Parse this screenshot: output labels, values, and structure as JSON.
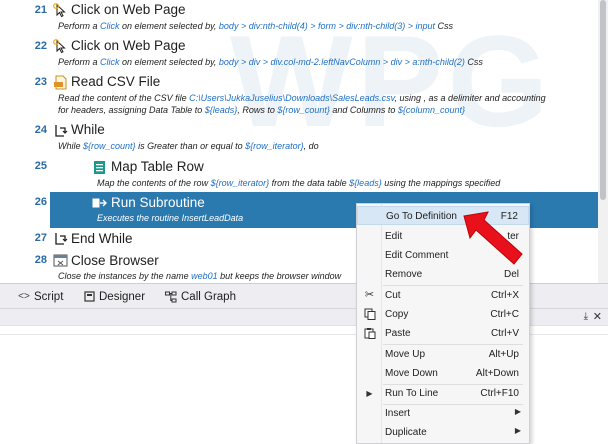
{
  "watermark": "WPG",
  "steps": [
    {
      "num": "21",
      "title": "Click on Web Page",
      "desc": [
        {
          "t": "Perform a "
        },
        {
          "t": "Click",
          "link": true
        },
        {
          "t": " on element selected by, "
        },
        {
          "t": "body > div:nth-child(4) > form > div:nth-child(3) > input",
          "link": true
        },
        {
          "t": " Css"
        }
      ]
    },
    {
      "num": "22",
      "title": "Click on Web Page",
      "desc": [
        {
          "t": "Perform a "
        },
        {
          "t": "Click",
          "link": true
        },
        {
          "t": " on element selected by, "
        },
        {
          "t": "body > div > div.col-md-2.leftNavColumn > div > a:nth-child(2)",
          "link": true
        },
        {
          "t": " Css"
        }
      ]
    },
    {
      "num": "23",
      "title": "Read CSV File",
      "desc": [
        {
          "t": "Read the content of the CSV file "
        },
        {
          "t": "C:\\Users\\JukkaJuselius\\Downloads\\SalesLeads.csv",
          "link": true
        },
        {
          "t": ", using , as a delimiter and  accounting"
        }
      ],
      "desc2": [
        {
          "t": "for headers, assigning Data Table to "
        },
        {
          "t": "${leads}",
          "link": true
        },
        {
          "t": ", Rows to "
        },
        {
          "t": "${row_count}",
          "link": true
        },
        {
          "t": " and Columns to "
        },
        {
          "t": "${column_count}",
          "link": true
        }
      ]
    },
    {
      "num": "24",
      "title": "While",
      "desc": [
        {
          "t": "While "
        },
        {
          "t": "${row_count}",
          "link": true
        },
        {
          "t": " is Greater than or equal to "
        },
        {
          "t": "${row_iterator}",
          "link": true
        },
        {
          "t": ", do"
        }
      ]
    },
    {
      "num": "25",
      "title": "Map Table Row",
      "desc": [
        {
          "t": "Map the contents of the row "
        },
        {
          "t": "${row_iterator}",
          "link": true
        },
        {
          "t": " from the data table "
        },
        {
          "t": "${leads}",
          "link": true
        },
        {
          "t": " using the mappings specified"
        }
      ]
    },
    {
      "num": "26",
      "title": "Run Subroutine",
      "desc": [
        {
          "t": "Executes the routine "
        },
        {
          "t": "InsertLeadData",
          "link": true
        }
      ]
    },
    {
      "num": "27",
      "title": "End While",
      "desc": []
    },
    {
      "num": "28",
      "title": "Close Browser",
      "desc": [
        {
          "t": "Close the instances by the name "
        },
        {
          "t": "web01",
          "link": true
        },
        {
          "t": " but keeps the browser window"
        }
      ]
    }
  ],
  "tabs": {
    "script": "Script",
    "designer": "Designer",
    "call_graph": "Call Graph"
  },
  "panel": {
    "pin": "⤓",
    "close": "✕"
  },
  "menu": {
    "go_to_definition": {
      "label": "Go To Definition",
      "key": "F12"
    },
    "edit": {
      "label": "Edit",
      "key": "ter"
    },
    "edit_comment": {
      "label": "Edit Comment",
      "key": "2"
    },
    "remove": {
      "label": "Remove",
      "key": "Del"
    },
    "cut": {
      "label": "Cut",
      "key": "Ctrl+X"
    },
    "copy": {
      "label": "Copy",
      "key": "Ctrl+C"
    },
    "paste": {
      "label": "Paste",
      "key": "Ctrl+V"
    },
    "move_up": {
      "label": "Move Up",
      "key": "Alt+Up"
    },
    "move_down": {
      "label": "Move Down",
      "key": "Alt+Down"
    },
    "run_to_line": {
      "label": "Run To Line",
      "key": "Ctrl+F10"
    },
    "insert": {
      "label": "Insert",
      "key": ""
    },
    "duplicate": {
      "label": "Duplicate",
      "key": ""
    }
  },
  "colors": {
    "selection": "#2a7ab0",
    "menu_highlight": "#d7e7f5",
    "pointer_arrow": "#e8101a",
    "link": "#1f6fc5",
    "line_number": "#2b6aa6"
  },
  "icons": {
    "click_step": "cursor-click-icon",
    "csv_step": "csv-file-icon",
    "while_step": "loop-icon",
    "map_step": "table-row-icon",
    "subroutine_step": "subroutine-icon",
    "close_step": "browser-close-icon"
  }
}
